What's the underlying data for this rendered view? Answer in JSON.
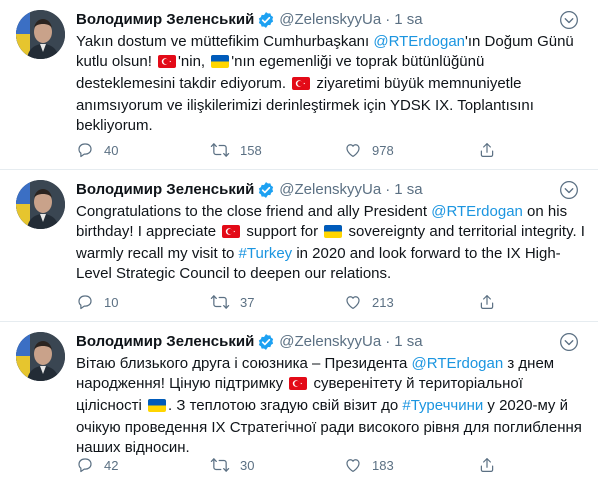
{
  "tweets": [
    {
      "author_name": "Володимир Зеленський",
      "handle": "@ZelenskyyUa",
      "time": "1 sa",
      "segments": [
        {
          "t": "text",
          "v": "Yakın dostum ve müttefikim Cumhurbaşkanı "
        },
        {
          "t": "mention",
          "v": "@RTErdogan"
        },
        {
          "t": "text",
          "v": "'ın Doğum Günü kutlu olsun! "
        },
        {
          "t": "flag",
          "v": "tr"
        },
        {
          "t": "text",
          "v": "'nin, "
        },
        {
          "t": "flag",
          "v": "ua"
        },
        {
          "t": "text",
          "v": "'nın egemenliği ve toprak bütünlüğünü desteklemesini takdir ediyorum. "
        },
        {
          "t": "flag",
          "v": "tr"
        },
        {
          "t": "text",
          "v": " ziyaretimi büyük memnuniyetle anımsıyorum ve ilişkilerimizi derinleştirmek için YDSK IX. Toplantısını bekliyorum."
        }
      ],
      "replies": "40",
      "retweets": "158",
      "likes": "978"
    },
    {
      "author_name": "Володимир Зеленський",
      "handle": "@ZelenskyyUa",
      "time": "1 sa",
      "segments": [
        {
          "t": "text",
          "v": "Congratulations to the close friend and ally President "
        },
        {
          "t": "mention",
          "v": "@RTErdogan"
        },
        {
          "t": "text",
          "v": " on his birthday! I appreciate "
        },
        {
          "t": "flag",
          "v": "tr"
        },
        {
          "t": "text",
          "v": " support for "
        },
        {
          "t": "flag",
          "v": "ua"
        },
        {
          "t": "text",
          "v": " sovereignty and territorial integrity. I warmly recall my visit to "
        },
        {
          "t": "hashtag",
          "v": "#Turkey"
        },
        {
          "t": "text",
          "v": " in 2020 and look forward to the IX High-Level Strategic Council to deepen our relations."
        }
      ],
      "replies": "10",
      "retweets": "37",
      "likes": "213"
    },
    {
      "author_name": "Володимир Зеленський",
      "handle": "@ZelenskyyUa",
      "time": "1 sa",
      "segments": [
        {
          "t": "text",
          "v": "Вітаю близького друга і союзника – Президента "
        },
        {
          "t": "mention",
          "v": "@RTErdogan"
        },
        {
          "t": "text",
          "v": " з днем народження! Ціную підтримку "
        },
        {
          "t": "flag",
          "v": "tr"
        },
        {
          "t": "text",
          "v": " суверенітету й територіальної цілісності "
        },
        {
          "t": "flag",
          "v": "ua"
        },
        {
          "t": "text",
          "v": ". З теплотою згадую свій візит до "
        },
        {
          "t": "hashtag",
          "v": "#Туреччини"
        },
        {
          "t": "text",
          "v": " у 2020-му й очікую проведення IX Стратегічної ради високого рівня для поглиблення наших відносин."
        }
      ],
      "replies": "42",
      "retweets": "30",
      "likes": "183"
    }
  ],
  "icons": {
    "verified": "verified-badge-icon",
    "more": "more-options-icon",
    "reply": "reply-icon",
    "retweet": "retweet-icon",
    "like": "heart-icon",
    "share": "share-icon"
  },
  "colors": {
    "accent": "#1b95e0",
    "secondary_text": "#5b7083",
    "divider": "#e6ecf0"
  }
}
